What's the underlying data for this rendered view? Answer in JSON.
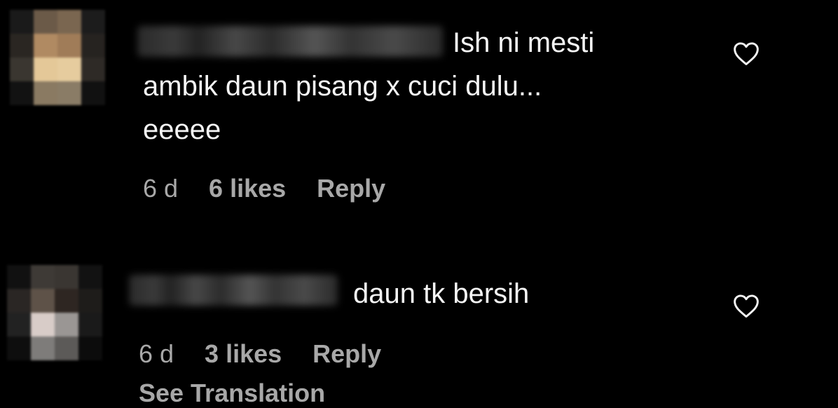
{
  "comments": [
    {
      "text_lines": [
        "Ish ni mesti",
        "ambik daun pisang x cuci dulu...",
        "eeeee"
      ],
      "time": "6 d",
      "likes": "6 likes",
      "reply_label": "Reply",
      "like_icon": "heart-outline-icon"
    },
    {
      "text_lines": [
        "daun tk bersih"
      ],
      "time": "6 d",
      "likes": "3 likes",
      "reply_label": "Reply",
      "see_translation": "See Translation",
      "like_icon": "heart-outline-icon"
    }
  ],
  "colors": {
    "background": "#000000",
    "text": "#f5f5f5",
    "meta": "#a8a8a8"
  }
}
